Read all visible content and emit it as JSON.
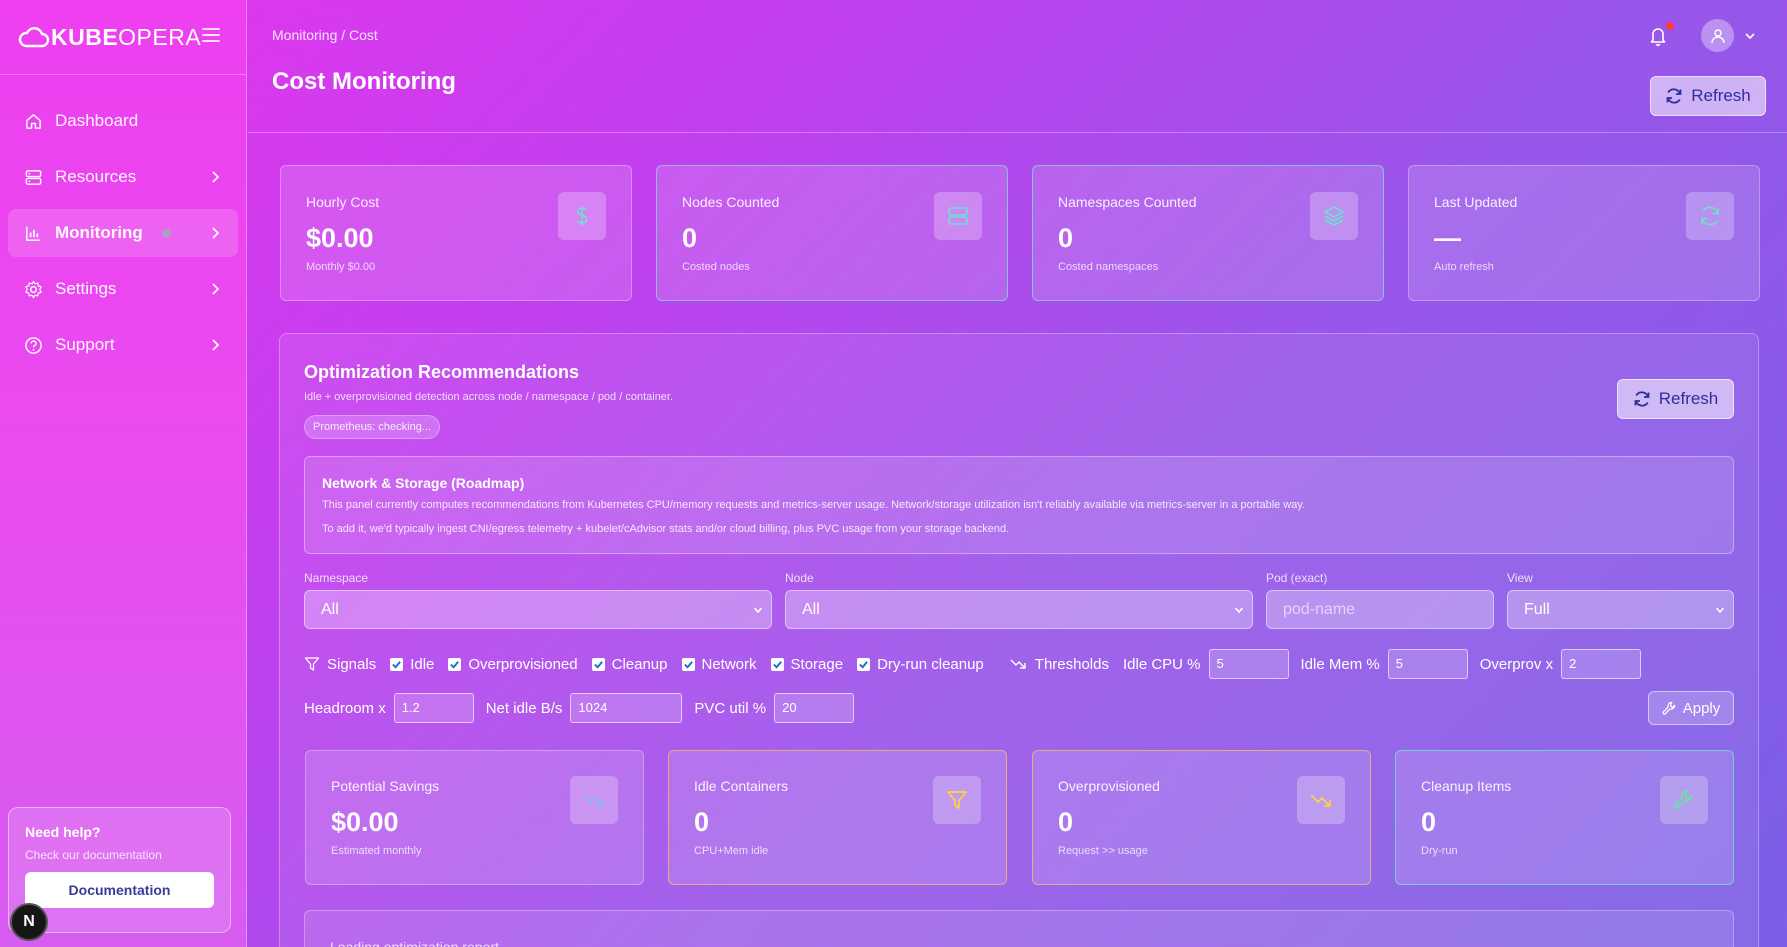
{
  "brand": {
    "bold": "KUBE",
    "light": "OPERA"
  },
  "sidebar": {
    "items": [
      {
        "label": "Dashboard",
        "icon": "home-icon"
      },
      {
        "label": "Resources",
        "icon": "server-icon"
      },
      {
        "label": "Monitoring",
        "icon": "bar-chart-icon",
        "active": true
      },
      {
        "label": "Settings",
        "icon": "gear-icon"
      },
      {
        "label": "Support",
        "icon": "help-circle-icon"
      }
    ],
    "help": {
      "title": "Need help?",
      "text": "Check our documentation",
      "button": "Documentation"
    },
    "badge": "N"
  },
  "header": {
    "breadcrumb": "Monitoring / Cost",
    "title": "Cost Monitoring",
    "refresh_label": "Refresh"
  },
  "stats": [
    {
      "label": "Hourly Cost",
      "value": "$0.00",
      "sub": "Monthly $0.00",
      "icon": "dollar-icon"
    },
    {
      "label": "Nodes Counted",
      "value": "0",
      "sub": "Costed nodes",
      "icon": "server-icon"
    },
    {
      "label": "Namespaces Counted",
      "value": "0",
      "sub": "Costed namespaces",
      "icon": "layers-icon"
    },
    {
      "label": "Last Updated",
      "value": "—",
      "sub": "Auto refresh",
      "icon": "refresh-icon"
    }
  ],
  "optimization": {
    "title": "Optimization Recommendations",
    "description": "Idle + overprovisioned detection across node / namespace / pod / container.",
    "prometheus_status": "Prometheus: checking...",
    "refresh_label": "Refresh",
    "roadmap": {
      "title": "Network & Storage (Roadmap)",
      "line1": "This panel currently computes recommendations from Kubernetes CPU/memory requests and metrics-server usage. Network/storage utilization isn't reliably available via metrics-server in a portable way.",
      "line2": "To add it, we'd typically ingest CNI/egress telemetry + kubelet/cAdvisor stats and/or cloud billing, plus PVC usage from your storage backend."
    },
    "filters": {
      "namespace_label": "Namespace",
      "namespace_value": "All",
      "node_label": "Node",
      "node_value": "All",
      "pod_label": "Pod (exact)",
      "pod_placeholder": "pod-name",
      "view_label": "View",
      "view_value": "Full"
    },
    "signals": {
      "label": "Signals",
      "items": [
        "Idle",
        "Overprovisioned",
        "Cleanup",
        "Network",
        "Storage",
        "Dry-run cleanup"
      ]
    },
    "thresholds": {
      "label": "Thresholds",
      "idle_cpu_label": "Idle CPU %",
      "idle_cpu_value": "5",
      "idle_mem_label": "Idle Mem %",
      "idle_mem_value": "5",
      "overprov_label": "Overprov x",
      "overprov_value": "2",
      "headroom_label": "Headroom x",
      "headroom_value": "1.2",
      "net_idle_label": "Net idle B/s",
      "net_idle_value": "1024",
      "pvc_util_label": "PVC util %",
      "pvc_util_value": "20",
      "apply_label": "Apply"
    },
    "summary": [
      {
        "label": "Potential Savings",
        "value": "$0.00",
        "sub": "Estimated monthly",
        "icon": "trend-down-icon"
      },
      {
        "label": "Idle Containers",
        "value": "0",
        "sub": "CPU+Mem idle",
        "icon": "filter-icon"
      },
      {
        "label": "Overprovisioned",
        "value": "0",
        "sub": "Request >> usage",
        "icon": "trend-down-icon"
      },
      {
        "label": "Cleanup Items",
        "value": "0",
        "sub": "Dry-run",
        "icon": "wrench-icon"
      }
    ],
    "loading_text": "Loading optimization report..."
  },
  "colors": {
    "accent_teal": "#6fe0d0",
    "accent_orange": "#f0b46e",
    "accent_yellow": "#ffd23f",
    "button_text": "#2d2f9e"
  }
}
